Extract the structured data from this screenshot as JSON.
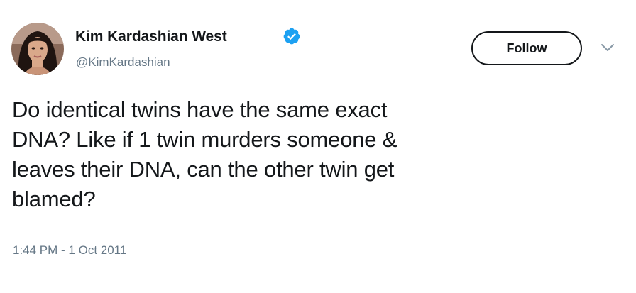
{
  "user": {
    "display_name": "Kim Kardashian West",
    "handle": "@KimKardashian",
    "verified": true,
    "avatar_icon": "profile-photo"
  },
  "follow_button": {
    "label": "Follow"
  },
  "menu": {
    "icon": "chevron-down-icon"
  },
  "tweet": {
    "text": "Do identical twins have the same exact\nDNA? Like if 1 twin murders someone &\nleaves their DNA, can the other twin get\nblamed?",
    "timestamp": "1:44 PM - 1 Oct 2011"
  },
  "colors": {
    "text_primary": "#14171a",
    "text_secondary": "#657786",
    "verified_blue": "#1da1f2",
    "background": "#ffffff"
  }
}
